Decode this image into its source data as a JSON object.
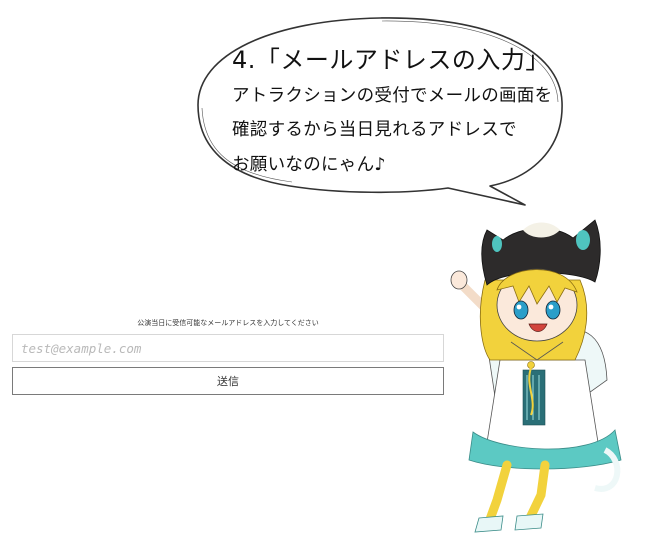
{
  "bubble": {
    "title": "4.「メールアドレスの入力」",
    "lines": [
      "アトラクションの受付でメールの画面を",
      "確認するから当日見れるアドレスで",
      "お願いなのにゃん♪"
    ]
  },
  "form": {
    "label": "公演当日に受信可能なメールアドレスを入力してください",
    "email_placeholder": "test@example.com",
    "email_value": "",
    "submit_label": "送信"
  },
  "colors": {
    "hair": "#f2d23c",
    "hood": "#2d2b2b",
    "teal": "#4fc4bf",
    "eyes": "#2a9ec9"
  }
}
